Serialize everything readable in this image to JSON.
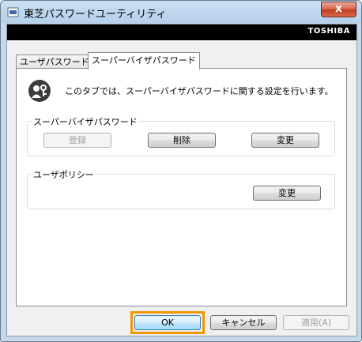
{
  "window": {
    "title": "東芝パスワードユーティリティ",
    "close_symbol": "x"
  },
  "brand": "TOSHIBA",
  "tabs": [
    {
      "label": "ユーザパスワード",
      "active": false
    },
    {
      "label": "スーパーバイザパスワード",
      "active": true
    }
  ],
  "info": {
    "icon": "user-key-icon",
    "text": "このタブでは、スーパーバイザパスワードに関する設定を行います。"
  },
  "supervisor_group": {
    "label": "スーパーバイザパスワード",
    "register_label": "登録",
    "delete_label": "削除",
    "change_label": "変更"
  },
  "policy_group": {
    "label": "ユーザポリシー",
    "change_label": "変更"
  },
  "footer": {
    "ok_label": "OK",
    "cancel_label": "キャンセル",
    "apply_label": "適用(A)"
  },
  "colors": {
    "highlight": "#f39700",
    "brandbar": "#000000"
  }
}
